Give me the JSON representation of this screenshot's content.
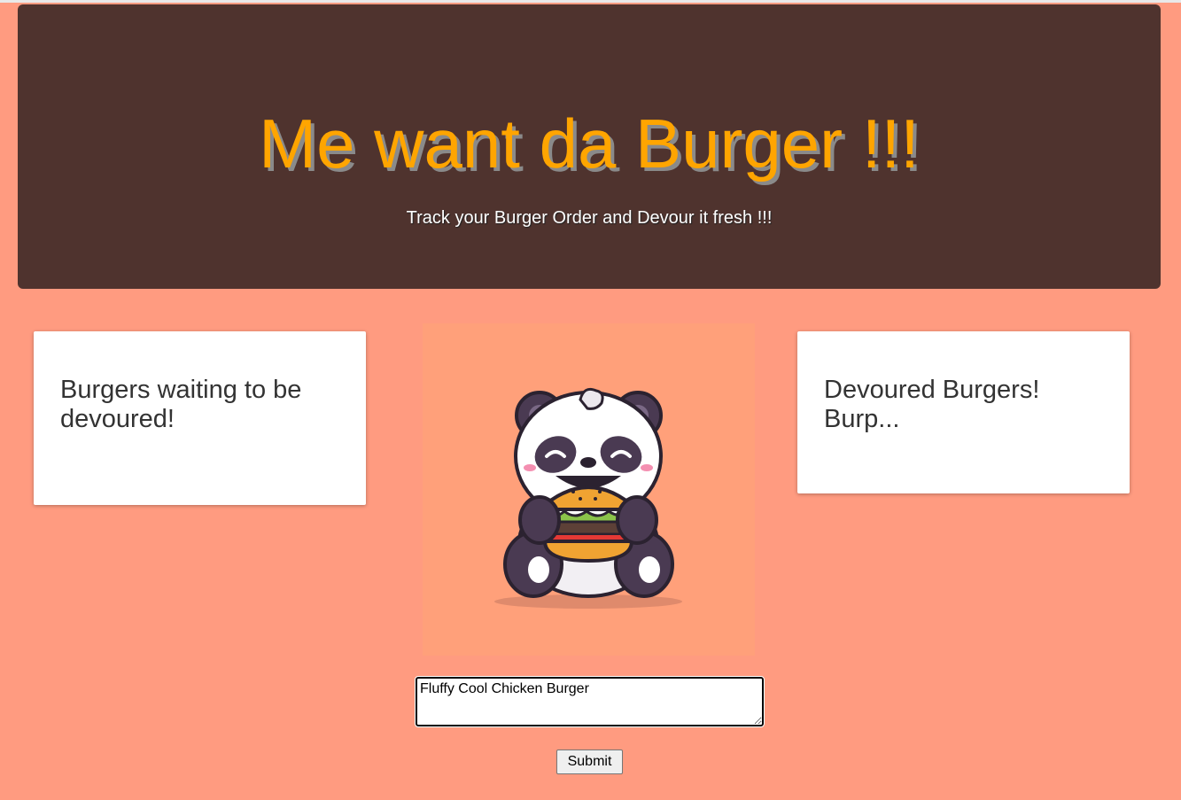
{
  "header": {
    "title": "Me want da Burger !!!",
    "subtitle": "Track your Burger Order and Devour it fresh !!!"
  },
  "waiting_panel": {
    "title": "Burgers waiting to be devoured!"
  },
  "devoured_panel": {
    "title": "Devoured Burgers! Burp..."
  },
  "illustration": {
    "icon": "panda-eating-burger-icon"
  },
  "form": {
    "burger_input_value": "Fluffy Cool Chicken Burger",
    "submit_label": "Submit"
  },
  "colors": {
    "page_background": "#ff9b80",
    "header_background": "#4f332e",
    "title_color": "#ffa500",
    "illustration_background": "#ffa07a"
  }
}
